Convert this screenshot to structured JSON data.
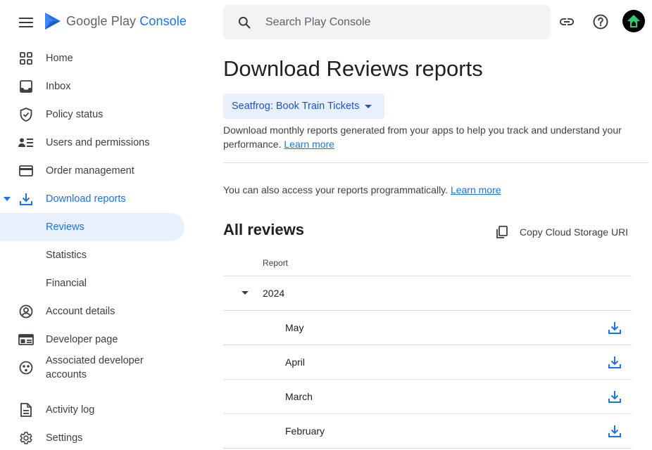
{
  "header": {
    "logo_prefix": "Google Play ",
    "logo_accent": "Console",
    "search_placeholder": "Search Play Console",
    "icons": [
      "menu-icon",
      "link-icon",
      "help-icon",
      "avatar"
    ]
  },
  "sidebar": {
    "items": [
      {
        "label": "Home",
        "icon": "home-grid-icon"
      },
      {
        "label": "Inbox",
        "icon": "inbox-icon"
      },
      {
        "label": "Policy status",
        "icon": "shield-check-icon"
      },
      {
        "label": "Users and permissions",
        "icon": "users-icon"
      },
      {
        "label": "Order management",
        "icon": "credit-card-icon"
      },
      {
        "label": "Download reports",
        "icon": "download-icon"
      },
      {
        "label": "Reviews"
      },
      {
        "label": "Statistics"
      },
      {
        "label": "Financial"
      },
      {
        "label": "Account details",
        "icon": "account-icon"
      },
      {
        "label": "Developer page",
        "icon": "developer-page-icon"
      },
      {
        "label": "Associated developer",
        "label2": "accounts",
        "icon": "associated-accounts-icon"
      },
      {
        "label": "Activity log",
        "icon": "activity-log-icon"
      },
      {
        "label": "Settings",
        "icon": "gear-icon"
      }
    ]
  },
  "main": {
    "title": "Download Reviews reports",
    "app_selector": "Seatfrog: Book Train Tickets",
    "description": "Download monthly reports generated from your apps to help you track and understand your performance.",
    "learn_more": "Learn more",
    "programmatic_text": "You can also access your reports programmatically.",
    "programmatic_link": "Learn more",
    "section_title": "All reviews",
    "copy_uri": "Copy Cloud Storage URI",
    "table": {
      "column_header": "Report",
      "year": "2024",
      "months": [
        "May",
        "April",
        "March",
        "February"
      ]
    }
  },
  "colors": {
    "accent": "#1a73e8",
    "selected_bg": "#e8f0fe",
    "search_bg": "#f1f3f4",
    "divider": "#dadce0"
  }
}
